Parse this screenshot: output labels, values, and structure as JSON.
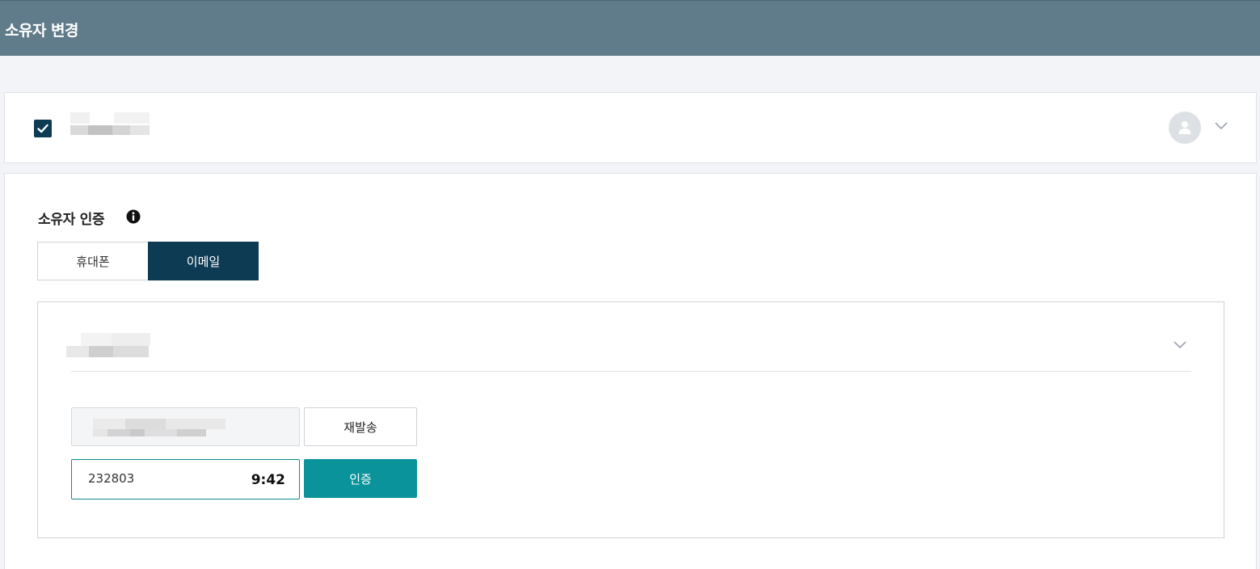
{
  "header": {
    "title": "소유자 변경"
  },
  "owner": {
    "checked": true,
    "icons": {
      "checkbox": "check-icon",
      "avatar": "user-icon",
      "expand": "chevron-down-icon"
    }
  },
  "auth": {
    "title": "소유자 인증",
    "info_icon": "info-icon",
    "tabs": [
      {
        "label": "휴대폰",
        "selected": false
      },
      {
        "label": "이메일",
        "selected": true
      }
    ],
    "resend_label": "재발송",
    "code_value": "232803",
    "timer": "9:42",
    "verify_label": "인증"
  },
  "colors": {
    "header_bg": "#607c8a",
    "primary_dark": "#0d3b54",
    "accent_teal": "#0a939a"
  }
}
